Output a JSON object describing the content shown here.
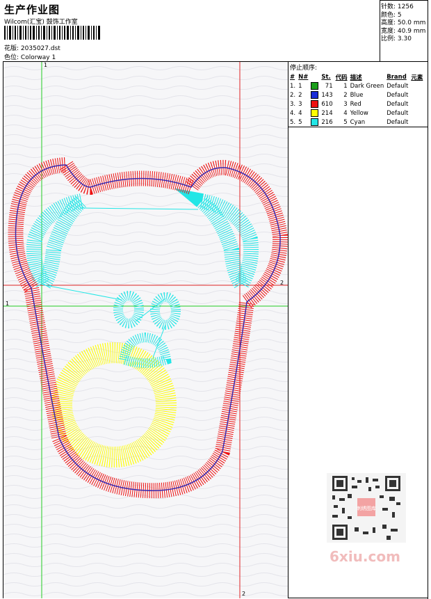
{
  "header": {
    "title": "生产作业图",
    "company": "Wilcom(汇宝) 鼓饰工作室",
    "design_label": "花版:",
    "design_value": "2035027.dst",
    "colorway_label": "色位:",
    "colorway_value": "Colorway 1"
  },
  "stats": [
    {
      "label": "针数:",
      "value": "1256"
    },
    {
      "label": "颜色:",
      "value": "5"
    },
    {
      "label": "高度:",
      "value": "50.0 mm"
    },
    {
      "label": "宽度:",
      "value": "40.9 mm"
    },
    {
      "label": "比例:",
      "value": "3.30"
    }
  ],
  "guides": {
    "v1_label": "1",
    "h1_label": "1",
    "v2_label": "2",
    "h2_label": "2"
  },
  "stop_order": {
    "title": "停止顺序:",
    "columns": [
      "#",
      "N#",
      "St.",
      "代码",
      "描述",
      "Brand",
      "元素"
    ],
    "rows": [
      {
        "idx": "1.",
        "n": "1",
        "color": "#1a9e1a",
        "st": "71",
        "code": "1",
        "desc": "Dark Green",
        "brand": "Default"
      },
      {
        "idx": "2.",
        "n": "2",
        "color": "#1a2bd6",
        "st": "143",
        "code": "2",
        "desc": "Blue",
        "brand": "Default"
      },
      {
        "idx": "3.",
        "n": "3",
        "color": "#ee1111",
        "st": "610",
        "code": "3",
        "desc": "Red",
        "brand": "Default"
      },
      {
        "idx": "4.",
        "n": "4",
        "color": "#ffff00",
        "st": "214",
        "code": "4",
        "desc": "Yellow",
        "brand": "Default"
      },
      {
        "idx": "5.",
        "n": "5",
        "color": "#22e6e6",
        "st": "216",
        "code": "5",
        "desc": "Cyan",
        "brand": "Default"
      }
    ]
  },
  "colors": {
    "red": "#ee1111",
    "cyan": "#22e6e6",
    "yellow": "#ffff00",
    "blue": "#3a2bb0",
    "guide_green": "#22cc22",
    "guide_red": "#dd2222"
  },
  "watermark": {
    "text": "6xiu.com",
    "qr_center_text": "刺绣图库"
  }
}
